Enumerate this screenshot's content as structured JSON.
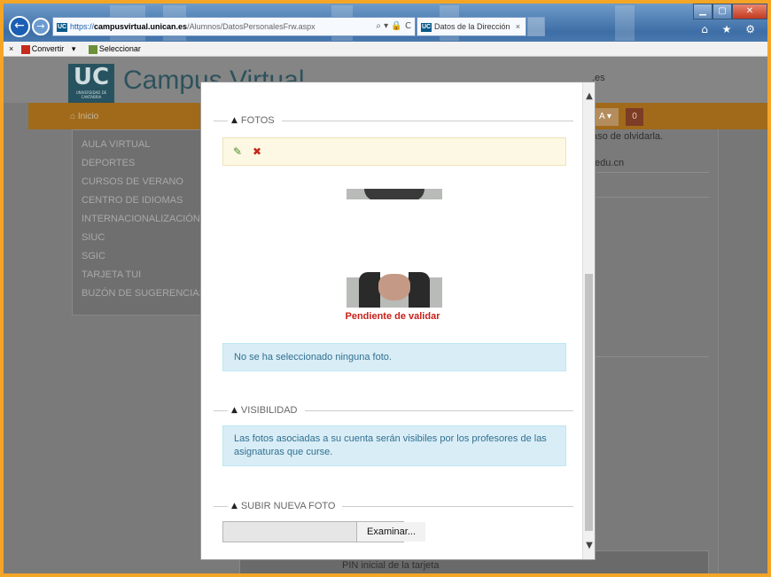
{
  "browser": {
    "url_https": "https://",
    "url_domain": "campusvirtual.unican.es",
    "url_path": "/Alumnos/DatosPersonalesFrw.aspx",
    "url_actions": "⌕ ▾ 🔒 C",
    "tab_title": "Datos de la Dirección",
    "tab_close": "×",
    "back_glyph": "←",
    "forward_glyph": "→",
    "win_min": "▁",
    "win_max": "▢",
    "win_close": "✕",
    "right_icons": "⌂ ★ ⚙",
    "favicon_text": "UC"
  },
  "toolbar": {
    "close": "×",
    "convert": "Convertir",
    "convert_arrow": "▾",
    "select": "Seleccionar"
  },
  "site": {
    "logo_text": "UC",
    "logo_sub": "UNIVERSIDAD DE CANTABRIA",
    "title": "Campus Virtual",
    "home": "Inicio",
    "lang": "A ▾",
    "badge": "0",
    "menu": [
      "AULA VIRTUAL",
      "DEPORTES",
      "CURSOS DE VERANO",
      "CENTRO DE IDIOMAS",
      "INTERNACIONALIZACIÓN",
      "SIUC",
      "SGIC",
      "TARJETA TUI",
      "BUZÓN DE SUGERENCIAS"
    ],
    "bg_text_1": ".es",
    "bg_text_2": "aso de olvidarla.",
    "bg_text_3": ".edu.cn",
    "bg_bottom": "PIN inicial de la tarjeta"
  },
  "modal": {
    "fotos_label": "FOTOS",
    "upload_icon": "✎",
    "delete_icon": "✖",
    "pending": "Pendiente de validar",
    "no_photo": "No se ha seleccionado ninguna foto.",
    "visibilidad_label": "VISIBILIDAD",
    "visibility_text": "Las fotos asociadas a su cuenta serán visibiles por los profesores de las asignaturas que curse.",
    "subir_label": "SUBIR NUEVA FOTO",
    "browse_button": "Examinar...",
    "caret": "▲",
    "scroll_up": "▲",
    "scroll_down": "▼"
  },
  "colors": {
    "frame": "#f4a526",
    "info_bg": "#d9edf7",
    "info_text": "#31708f",
    "pending": "#c9201a",
    "warning_bg": "#fcf8e3"
  }
}
